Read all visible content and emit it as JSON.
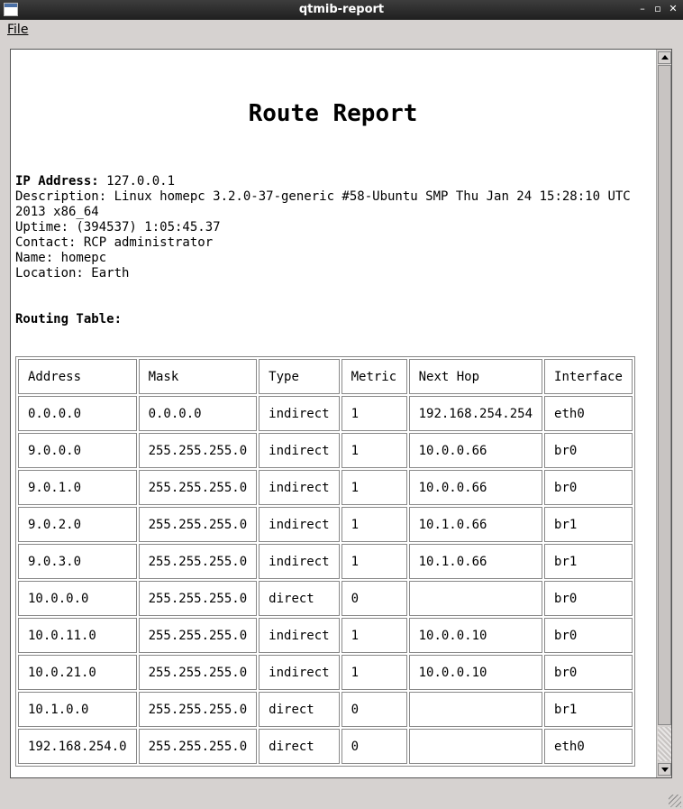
{
  "window": {
    "title": "qtmib-report",
    "minimize": "–",
    "maximize": "▫",
    "close": "✕"
  },
  "menu": {
    "file_label": "File"
  },
  "report": {
    "title": "Route Report",
    "ip": {
      "label": "IP Address:",
      "value": "127.0.0.1"
    },
    "description": "Description: Linux homepc 3.2.0-37-generic #58-Ubuntu SMP Thu Jan 24 15:28:10 UTC 2013 x86_64",
    "uptime": "Uptime: (394537) 1:05:45.37",
    "contact": "Contact: RCP administrator",
    "name": "Name: homepc",
    "location": "Location: Earth",
    "routing_label": "Routing Table:"
  },
  "table": {
    "headers": [
      "Address",
      "Mask",
      "Type",
      "Metric",
      "Next Hop",
      "Interface"
    ],
    "rows": [
      [
        "0.0.0.0",
        "0.0.0.0",
        "indirect",
        "1",
        "192.168.254.254",
        "eth0"
      ],
      [
        "9.0.0.0",
        "255.255.255.0",
        "indirect",
        "1",
        "10.0.0.66",
        "br0"
      ],
      [
        "9.0.1.0",
        "255.255.255.0",
        "indirect",
        "1",
        "10.0.0.66",
        "br0"
      ],
      [
        "9.0.2.0",
        "255.255.255.0",
        "indirect",
        "1",
        "10.1.0.66",
        "br1"
      ],
      [
        "9.0.3.0",
        "255.255.255.0",
        "indirect",
        "1",
        "10.1.0.66",
        "br1"
      ],
      [
        "10.0.0.0",
        "255.255.255.0",
        "direct",
        "0",
        "",
        "br0"
      ],
      [
        "10.0.11.0",
        "255.255.255.0",
        "indirect",
        "1",
        "10.0.0.10",
        "br0"
      ],
      [
        "10.0.21.0",
        "255.255.255.0",
        "indirect",
        "1",
        "10.0.0.10",
        "br0"
      ],
      [
        "10.1.0.0",
        "255.255.255.0",
        "direct",
        "0",
        "",
        "br1"
      ],
      [
        "192.168.254.0",
        "255.255.255.0",
        "direct",
        "0",
        "",
        "eth0"
      ]
    ]
  }
}
